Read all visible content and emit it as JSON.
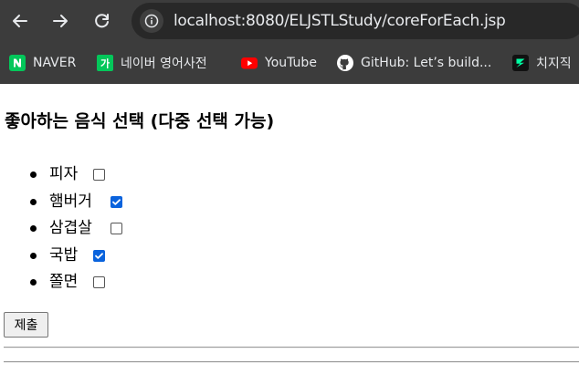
{
  "browser": {
    "url": "localhost:8080/ELJSTLStudy/coreForEach.jsp",
    "bookmarks": [
      {
        "label": "NAVER",
        "icon": "naver-icon",
        "color": "#03c75a"
      },
      {
        "label": "네이버 영어사전",
        "icon": "naver-dictionary-icon",
        "color": "#03c75a"
      },
      {
        "label": "YouTube",
        "icon": "youtube-icon",
        "color": "#ff0000"
      },
      {
        "label": "GitHub: Let’s build...",
        "icon": "github-icon",
        "color": "#ffffff"
      },
      {
        "label": "치지직",
        "icon": "chzzk-icon",
        "color": "#00ffa3"
      }
    ]
  },
  "page": {
    "title": "좋아하는 음식 선택 (다중 선택 가능)",
    "foods": [
      {
        "label": "피자",
        "checked": false
      },
      {
        "label": "햄버거",
        "checked": true
      },
      {
        "label": "삼겹살",
        "checked": false
      },
      {
        "label": "국밥",
        "checked": true
      },
      {
        "label": "쫄면",
        "checked": false
      }
    ],
    "submit_label": "제출"
  }
}
